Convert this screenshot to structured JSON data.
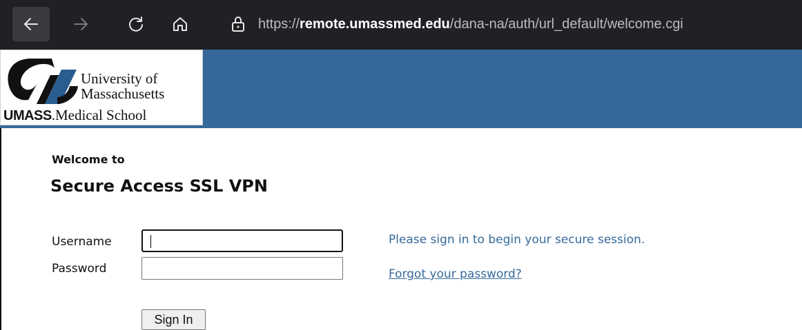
{
  "browser": {
    "url_scheme": "https://",
    "url_host": "remote.umassmed.edu",
    "url_path": "/dana-na/auth/url_default/welcome.cgi",
    "icons": [
      "back-arrow-icon",
      "forward-arrow-icon",
      "reload-icon",
      "home-icon",
      "lock-icon"
    ]
  },
  "header": {
    "logo_line1": "University of",
    "logo_line2": "Massachusetts",
    "logo_umass": "UMASS",
    "logo_line3": ".Medical School",
    "bar_color": "#35699a"
  },
  "login": {
    "welcome": "Welcome to",
    "title": "Secure Access SSL VPN",
    "username_label": "Username",
    "password_label": "Password",
    "username_value": "",
    "password_value": "",
    "signin_label": "Sign In",
    "message": "Please sign in to begin your secure session.",
    "forgot_link": "Forgot your password?",
    "link_color": "#35699a"
  }
}
